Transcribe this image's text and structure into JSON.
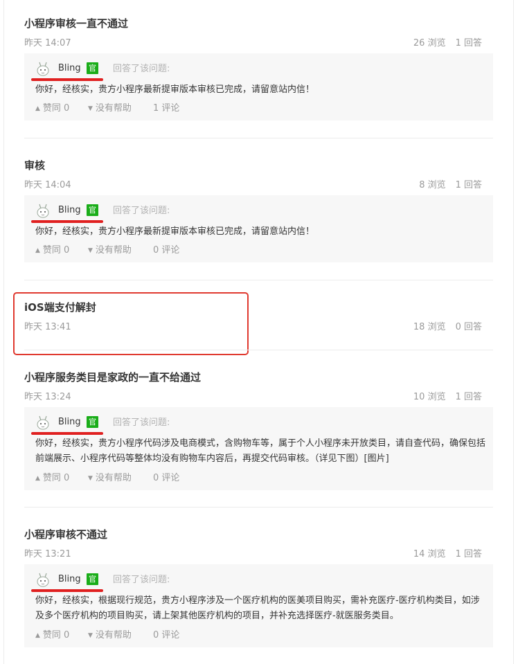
{
  "questions": [
    {
      "title": "小程序审核一直不通过",
      "time": "昨天 14:07",
      "views": "26 浏览",
      "answers": "1 回答",
      "answer": {
        "name": "Bling",
        "badge": "官",
        "hint": "回答了该问题:",
        "text": "你好，经核实，贵方小程序最新提审版本审核已完成，请留意站内信！",
        "like": "赞同 0",
        "unhelpful": "没有帮助",
        "comments": "1 评论"
      }
    },
    {
      "title": "审核",
      "time": "昨天 14:04",
      "views": "8 浏览",
      "answers": "1 回答",
      "answer": {
        "name": "Bling",
        "badge": "官",
        "hint": "回答了该问题:",
        "text": "你好，经核实，贵方小程序最新提审版本审核已完成，请留意站内信！",
        "like": "赞同 0",
        "unhelpful": "没有帮助",
        "comments": "0 评论"
      }
    },
    {
      "title": "iOS端支付解封",
      "time": "昨天 13:41",
      "views": "18 浏览",
      "answers": "0 回答"
    },
    {
      "title": "小程序服务类目是家政的一直不给通过",
      "time": "昨天 13:24",
      "views": "10 浏览",
      "answers": "1 回答",
      "answer": {
        "name": "Bling",
        "badge": "官",
        "hint": "回答了该问题:",
        "text": "你好，经核实，贵方小程序代码涉及电商模式，含购物车等，属于个人小程序未开放类目，请自查代码，确保包括前端展示、小程序代码等整体均没有购物车内容后，再提交代码审核。（详见下图）[图片]",
        "like": "赞同 0",
        "unhelpful": "没有帮助",
        "comments": "0 评论"
      }
    },
    {
      "title": "小程序审核不通过",
      "time": "昨天 13:21",
      "views": "14 浏览",
      "answers": "1 回答",
      "answer": {
        "name": "Bling",
        "badge": "官",
        "hint": "回答了该问题:",
        "text": "你好，经核实，根据现行规范，贵方小程序涉及一个医疗机构的医美项目购买，需补充医疗-医疗机构类目，如涉及多个医疗机构的项目购买，请上架其他医疗机构的项目，并补充选择医疗-就医服务类目。",
        "like": "赞同 0",
        "unhelpful": "没有帮助",
        "comments": "0 评论"
      }
    }
  ],
  "colors": {
    "badge": "#1aad19",
    "underline_annotation": "#e02020",
    "highlight_box": "#e0392f",
    "answer_bg": "#f7f7f7"
  },
  "icons": [
    "avatar-icon",
    "thumbs-up-triangle-icon",
    "unhelpful-triangle-icon"
  ]
}
